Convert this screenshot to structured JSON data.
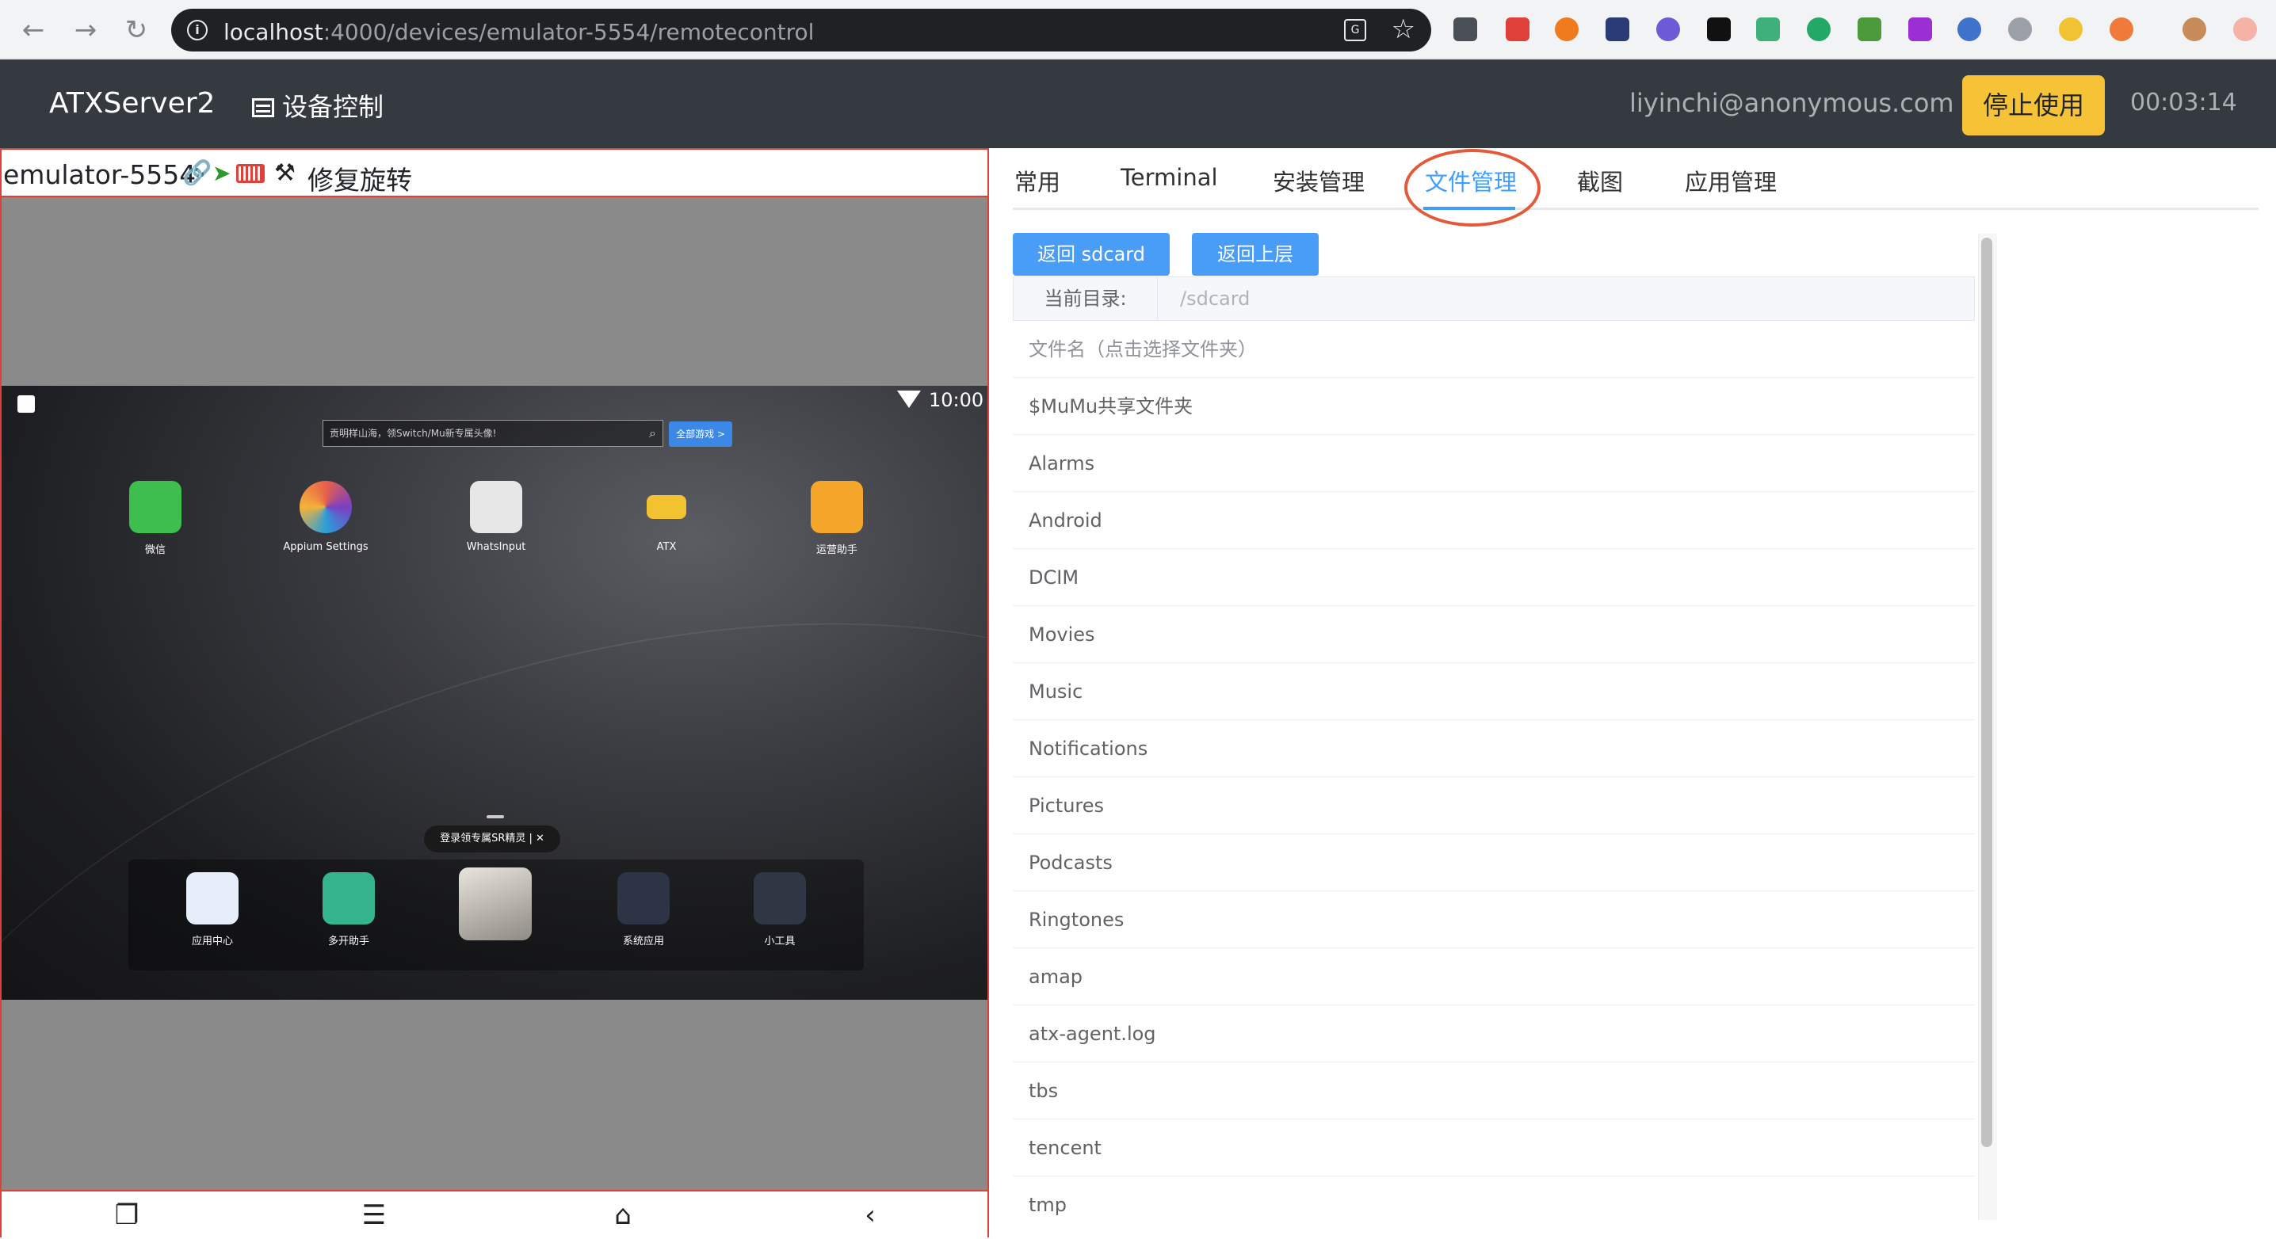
{
  "browser": {
    "url_host": "localhost",
    "url_rest": ":4000/devices/emulator-5554/remotecontrol"
  },
  "navbar": {
    "brand": "ATXServer2",
    "device_control": "设备控制",
    "user": "liyinchi@anonymous.com",
    "stop_button": "停止使用",
    "timer": "00:03:14"
  },
  "device": {
    "name": "emulator-5554",
    "fix_rotate": "修复旋转",
    "status_time": "10:00",
    "search_placeholder": "贡明样山海，领Switch/Mu新专属头像!",
    "all_games": "全部游戏 >",
    "apps": [
      {
        "label": "微信",
        "color": "#3dbe4f"
      },
      {
        "label": "Appium Settings",
        "color": "#e8604a"
      },
      {
        "label": "WhatsInput",
        "color": "#e7e7e7"
      },
      {
        "label": "ATX",
        "color": "#f2c230"
      },
      {
        "label": "运营助手",
        "color": "#f4a62a"
      }
    ],
    "dock_hint": "登录领专属SR精灵 | ✕",
    "dock_apps": [
      {
        "label": "应用中心",
        "color": "#e6eef9"
      },
      {
        "label": "多开助手",
        "color": "#35b38c"
      },
      {
        "label": "",
        "color": "#b9b4ad"
      },
      {
        "label": "系统应用",
        "color": "#2d3445"
      },
      {
        "label": "小工具",
        "color": "#2f3644"
      }
    ]
  },
  "tabs": {
    "items": [
      "常用",
      "Terminal",
      "安装管理",
      "文件管理",
      "截图",
      "应用管理"
    ],
    "active": "文件管理"
  },
  "file_manager": {
    "back_sdcard": "返回 sdcard",
    "back_up": "返回上层",
    "current_dir_label": "当前目录:",
    "current_dir_value": "/sdcard",
    "column_header": "文件名（点击选择文件夹）",
    "files": [
      "$MuMu共享文件夹",
      "Alarms",
      "Android",
      "DCIM",
      "Movies",
      "Music",
      "Notifications",
      "Pictures",
      "Podcasts",
      "Ringtones",
      "amap",
      "atx-agent.log",
      "tbs",
      "tencent",
      "tmp"
    ]
  },
  "colors": {
    "accent": "#409eff",
    "navbar_bg": "#343a40",
    "stop_button": "#f6c236",
    "device_border": "#e0403a"
  }
}
